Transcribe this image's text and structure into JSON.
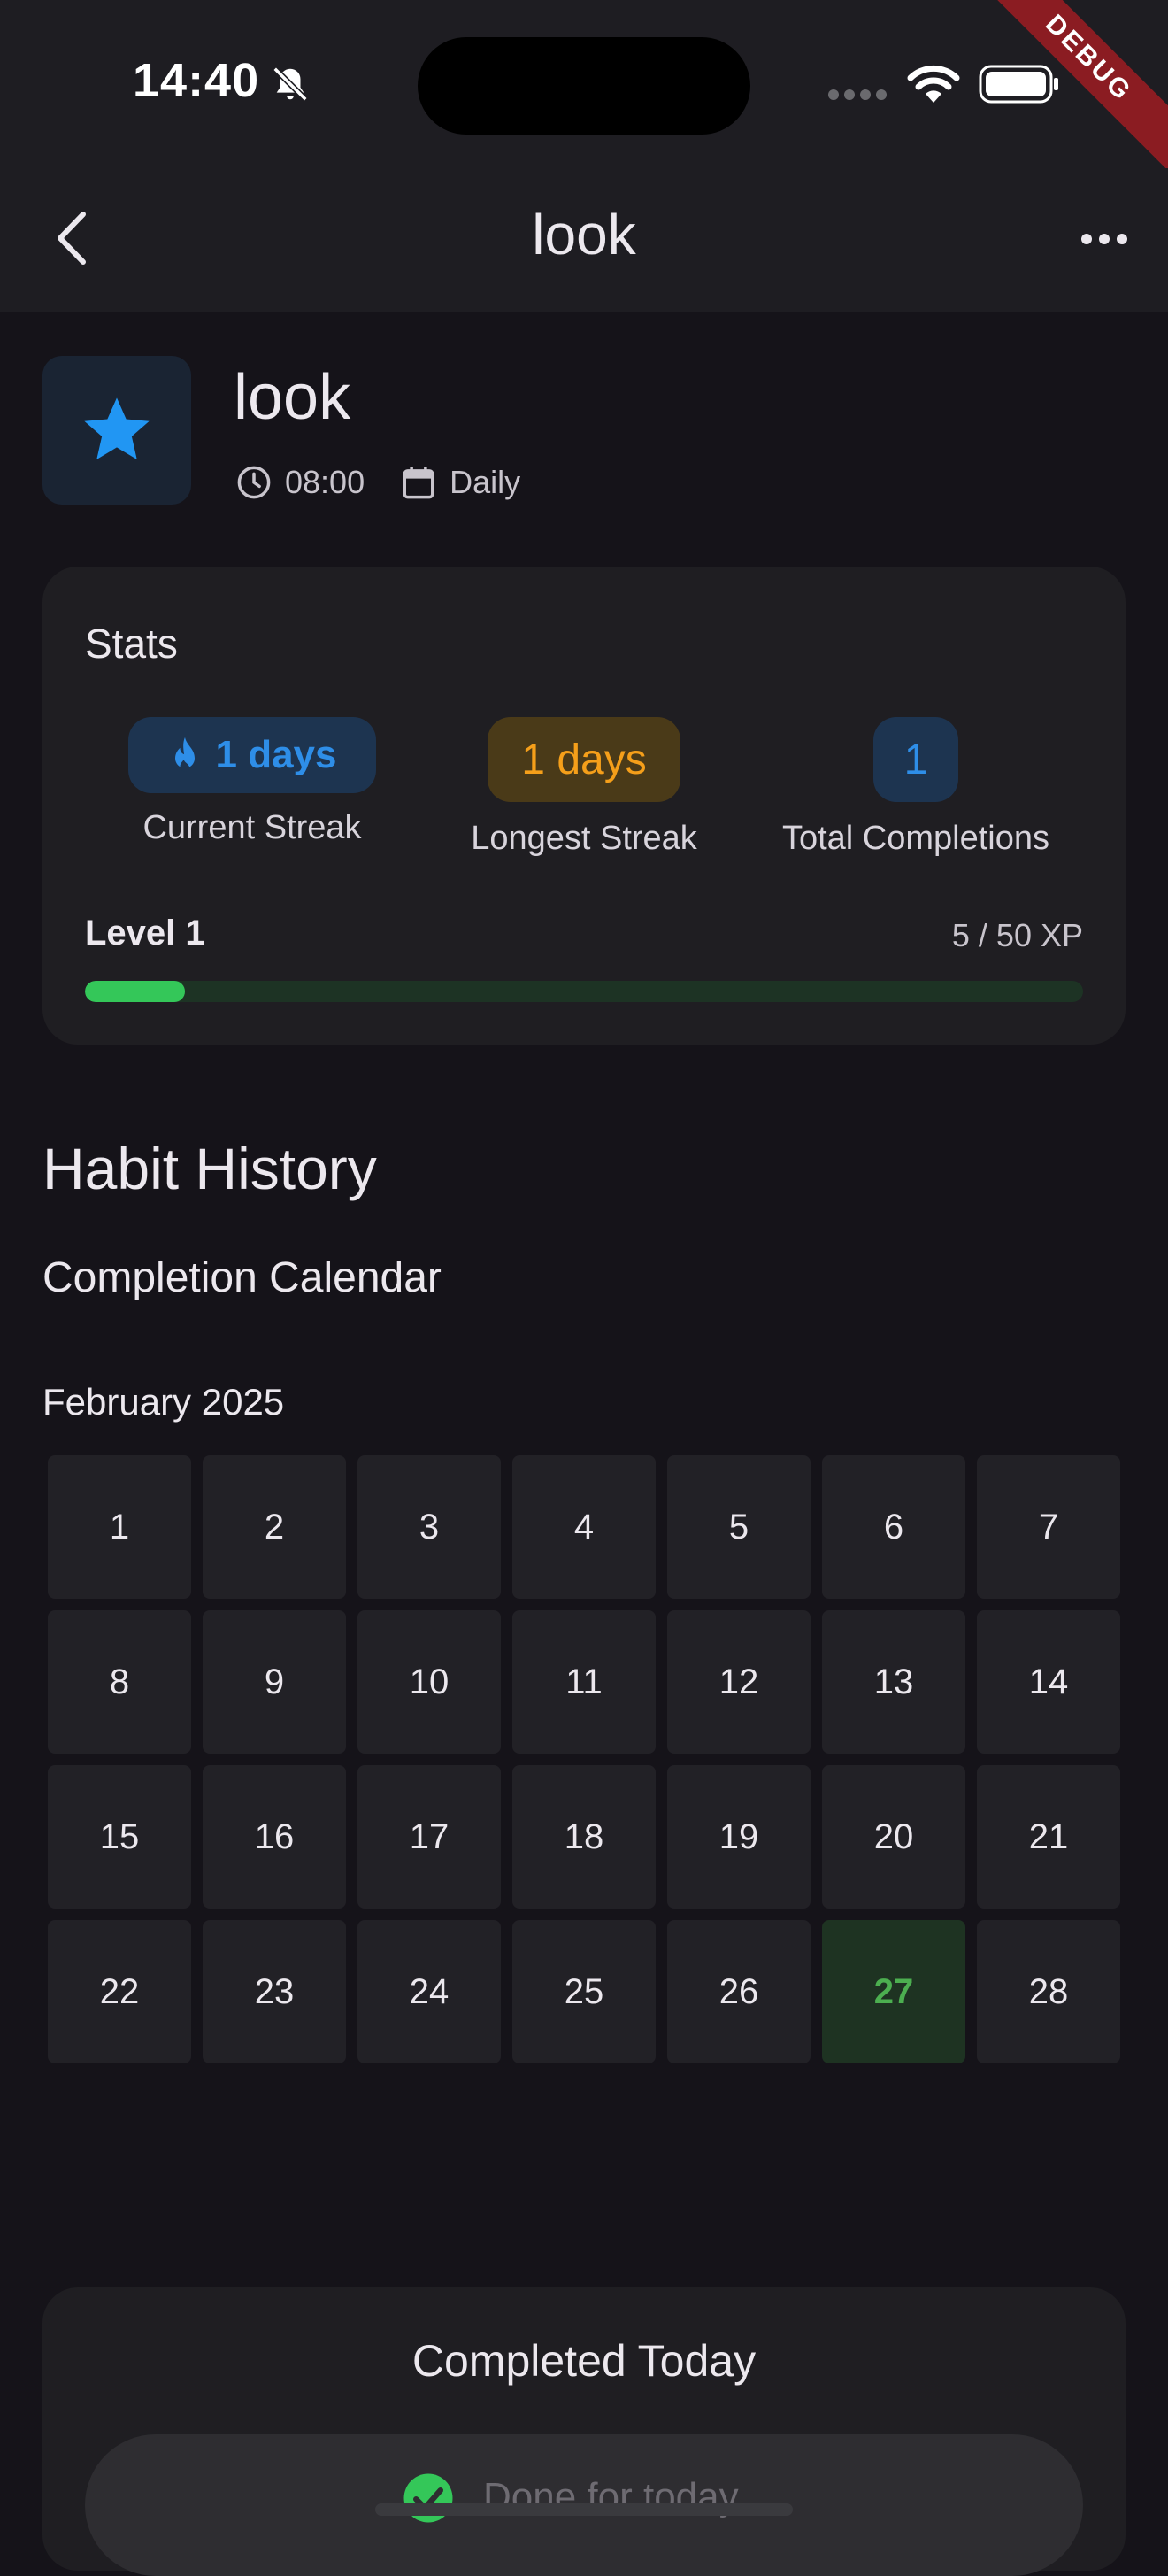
{
  "status_bar": {
    "time": "14:40",
    "debug_label": "DEBUG"
  },
  "app_bar": {
    "title": "look"
  },
  "habit": {
    "name": "look",
    "icon": "star-icon",
    "time": "08:00",
    "frequency": "Daily",
    "accent_color": "#2196f3"
  },
  "stats": {
    "title": "Stats",
    "current_streak": {
      "value": "1 days",
      "label": "Current Streak"
    },
    "longest_streak": {
      "value": "1 days",
      "label": "Longest Streak"
    },
    "total_completions": {
      "value": "1",
      "label": "Total Completions"
    },
    "level_label": "Level 1",
    "xp_label": "5 / 50 XP",
    "xp_progress": 0.1,
    "xp_color": "#34c759"
  },
  "history": {
    "title": "Habit History",
    "calendar_title": "Completion Calendar",
    "month": "February 2025",
    "days": [
      "1",
      "2",
      "3",
      "4",
      "5",
      "6",
      "7",
      "8",
      "9",
      "10",
      "11",
      "12",
      "13",
      "14",
      "15",
      "16",
      "17",
      "18",
      "19",
      "20",
      "21",
      "22",
      "23",
      "24",
      "25",
      "26",
      "27",
      "28"
    ],
    "completed_days": [
      "27"
    ]
  },
  "completed_today": {
    "title": "Completed Today",
    "button_label": "Done for today"
  }
}
